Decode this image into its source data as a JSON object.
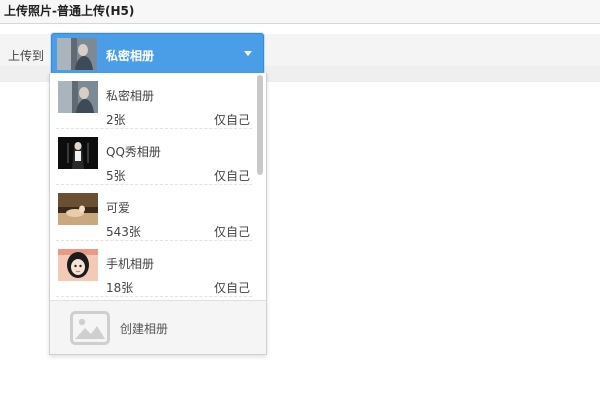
{
  "window": {
    "title": "上传照片-普通上传(H5)"
  },
  "upload": {
    "label": "上传到",
    "selected_album": "私密相册",
    "selected_thumb_icon": "photo-thumbnail-icon"
  },
  "dropdown": {
    "albums": [
      {
        "name": "私密相册",
        "count": "2张",
        "privacy": "仅自己"
      },
      {
        "name": "QQ秀相册",
        "count": "5张",
        "privacy": "仅自己"
      },
      {
        "name": "可爱",
        "count": "543张",
        "privacy": "仅自己"
      },
      {
        "name": "手机相册",
        "count": "18张",
        "privacy": "仅自己"
      }
    ],
    "create_label": "创建相册",
    "create_icon": "image-placeholder-icon"
  },
  "colors": {
    "accent": "#4a9ee8",
    "title_text": "#222222",
    "dropdown_footer": "#f5f5f5"
  }
}
